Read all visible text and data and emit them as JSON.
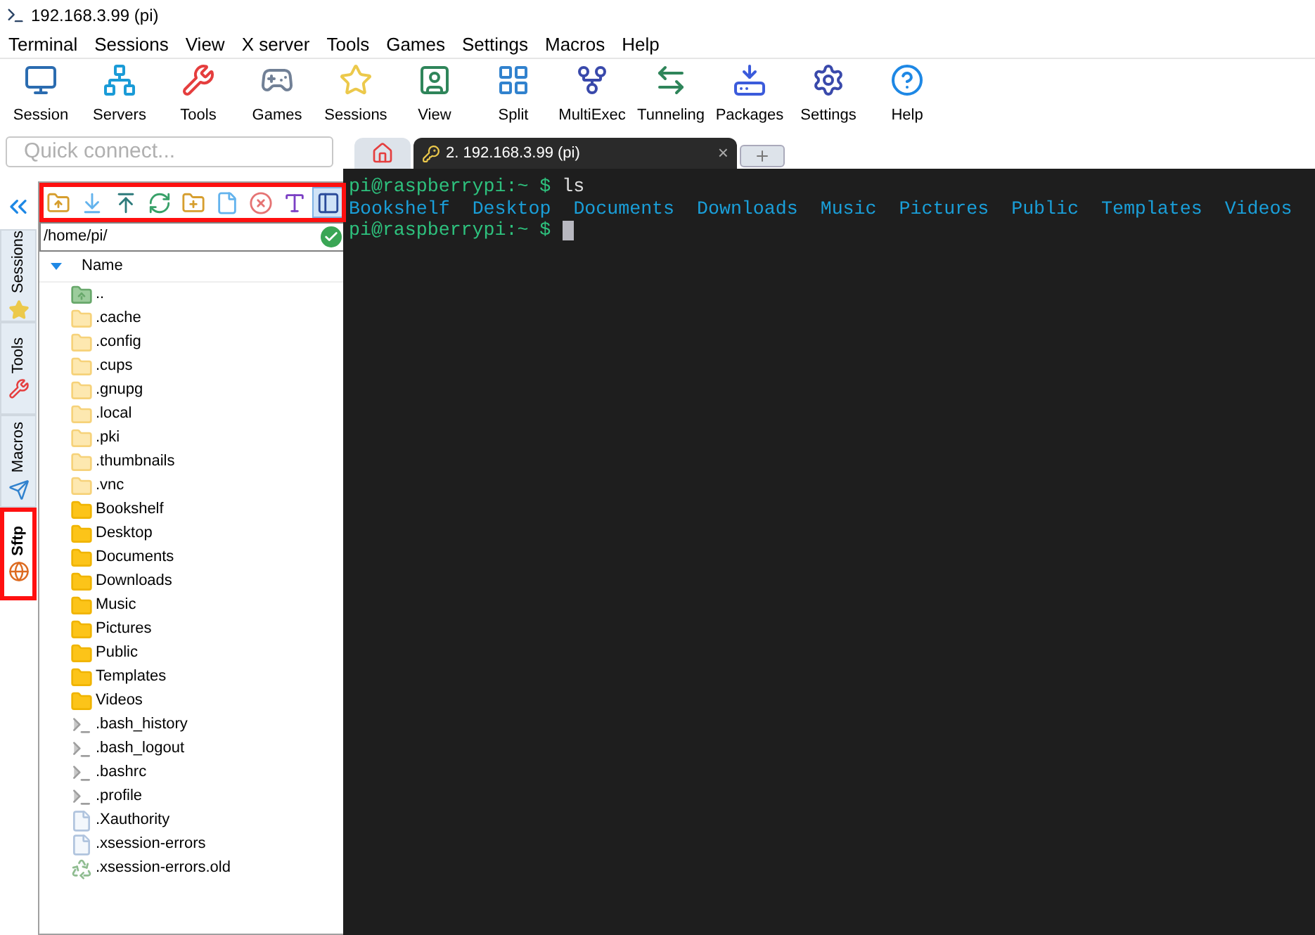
{
  "window": {
    "title": "192.168.3.99 (pi)"
  },
  "menu": [
    "Terminal",
    "Sessions",
    "View",
    "X server",
    "Tools",
    "Games",
    "Settings",
    "Macros",
    "Help"
  ],
  "toolbar": [
    {
      "label": "Session",
      "kind": "session"
    },
    {
      "label": "Servers",
      "kind": "servers"
    },
    {
      "label": "Tools",
      "kind": "tools"
    },
    {
      "label": "Games",
      "kind": "games"
    },
    {
      "label": "Sessions",
      "kind": "star"
    },
    {
      "label": "View",
      "kind": "view"
    },
    {
      "label": "Split",
      "kind": "split"
    },
    {
      "label": "MultiExec",
      "kind": "fork"
    },
    {
      "label": "Tunneling",
      "kind": "tunnel"
    },
    {
      "label": "Packages",
      "kind": "packages"
    },
    {
      "label": "Settings",
      "kind": "gears"
    },
    {
      "label": "Help",
      "kind": "help"
    }
  ],
  "quick_connect": {
    "placeholder": "Quick connect..."
  },
  "side_tabs": [
    {
      "label": "Sessions",
      "kind": "star",
      "selected": false,
      "highlighted": false
    },
    {
      "label": "Tools",
      "kind": "tools",
      "selected": false,
      "highlighted": false
    },
    {
      "label": "Macros",
      "kind": "plane",
      "selected": false,
      "highlighted": false
    },
    {
      "label": "Sftp",
      "kind": "globe",
      "selected": true,
      "highlighted": true
    }
  ],
  "sftp": {
    "toolbar_highlighted": true,
    "tools": [
      {
        "kind": "up"
      },
      {
        "kind": "download"
      },
      {
        "kind": "upload"
      },
      {
        "kind": "refresh"
      },
      {
        "kind": "new-folder"
      },
      {
        "kind": "new-file"
      },
      {
        "kind": "delete"
      },
      {
        "kind": "text"
      },
      {
        "kind": "follow",
        "selected": true
      }
    ],
    "path": "/home/pi/",
    "column": "Name",
    "files": [
      {
        "name": "..",
        "kind": "up"
      },
      {
        "name": ".cache",
        "kind": "hidden-folder"
      },
      {
        "name": ".config",
        "kind": "hidden-folder"
      },
      {
        "name": ".cups",
        "kind": "hidden-folder"
      },
      {
        "name": ".gnupg",
        "kind": "hidden-folder"
      },
      {
        "name": ".local",
        "kind": "hidden-folder"
      },
      {
        "name": ".pki",
        "kind": "hidden-folder"
      },
      {
        "name": ".thumbnails",
        "kind": "hidden-folder"
      },
      {
        "name": ".vnc",
        "kind": "hidden-folder"
      },
      {
        "name": "Bookshelf",
        "kind": "folder"
      },
      {
        "name": "Desktop",
        "kind": "folder"
      },
      {
        "name": "Documents",
        "kind": "folder"
      },
      {
        "name": "Downloads",
        "kind": "folder"
      },
      {
        "name": "Music",
        "kind": "folder"
      },
      {
        "name": "Pictures",
        "kind": "folder"
      },
      {
        "name": "Public",
        "kind": "folder"
      },
      {
        "name": "Templates",
        "kind": "folder"
      },
      {
        "name": "Videos",
        "kind": "folder"
      },
      {
        "name": ".bash_history",
        "kind": "script"
      },
      {
        "name": ".bash_logout",
        "kind": "script"
      },
      {
        "name": ".bashrc",
        "kind": "script"
      },
      {
        "name": ".profile",
        "kind": "script"
      },
      {
        "name": ".Xauthority",
        "kind": "file"
      },
      {
        "name": ".xsession-errors",
        "kind": "file"
      },
      {
        "name": ".xsession-errors.old",
        "kind": "recycled"
      }
    ]
  },
  "tabs": [
    {
      "kind": "home",
      "selected": false
    },
    {
      "kind": "session",
      "label": "2. 192.168.3.99 (pi)",
      "close": "×",
      "selected": true
    },
    {
      "kind": "new",
      "selected": false
    }
  ],
  "terminal": {
    "lines": [
      {
        "kind": "prompt",
        "prompt": "pi@raspberrypi:~ $",
        "command": "ls",
        "cursor": false
      },
      {
        "kind": "listing",
        "items": [
          "Bookshelf",
          "Desktop",
          "Documents",
          "Downloads",
          "Music",
          "Pictures",
          "Public",
          "Templates",
          "Videos"
        ]
      },
      {
        "kind": "prompt",
        "prompt": "pi@raspberrypi:~ $",
        "cursor": true
      }
    ]
  }
}
